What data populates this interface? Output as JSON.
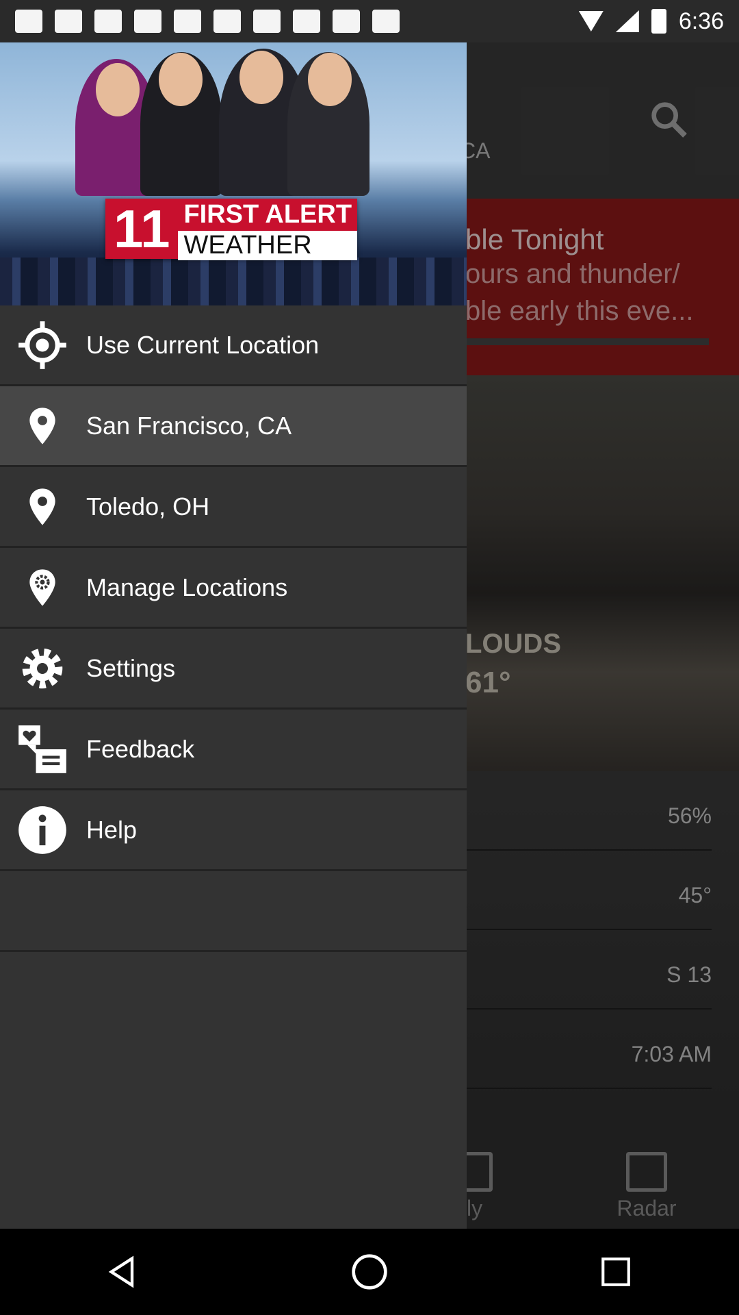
{
  "status_bar": {
    "time": "6:36"
  },
  "background": {
    "location_fragment": "CA",
    "alert_title": "ble Tonight",
    "alert_line1": "ours and thunder/",
    "alert_line2": "ble early this eve...",
    "condition": "LOUDS",
    "temperature": "61°",
    "stats": [
      "56%",
      "45°",
      "S 13",
      "7:03 AM"
    ],
    "tabs": [
      {
        "label": "ily"
      },
      {
        "label": "Radar"
      }
    ]
  },
  "drawer": {
    "banner": {
      "logo_number": "11",
      "logo_line1": "FIRST ALERT",
      "logo_line2": "WEATHER"
    },
    "items": [
      {
        "label": "Use Current Location",
        "icon": "target-icon"
      },
      {
        "label": "San Francisco, CA",
        "icon": "location-pin-icon"
      },
      {
        "label": "Toledo, OH",
        "icon": "location-pin-icon"
      },
      {
        "label": "Manage Locations",
        "icon": "location-gear-icon"
      },
      {
        "label": "Settings",
        "icon": "gear-icon"
      },
      {
        "label": "Feedback",
        "icon": "feedback-icon"
      },
      {
        "label": "Help",
        "icon": "info-icon"
      }
    ]
  }
}
